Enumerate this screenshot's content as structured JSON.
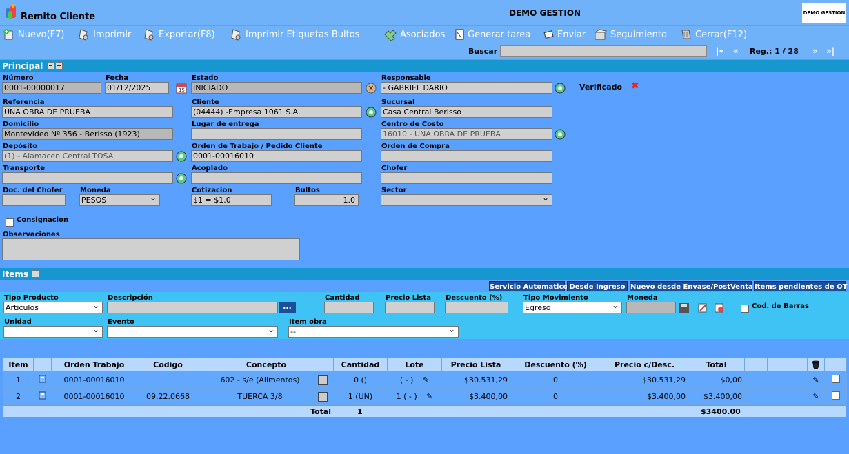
{
  "header": {
    "title": "Remito Cliente",
    "company": "DEMO GESTION",
    "brand_logo": "DEMO GESTION"
  },
  "toolbar": [
    {
      "label": "Nuevo(F7)",
      "icon": "new-icon"
    },
    {
      "label": "Imprimir",
      "icon": "print-icon"
    },
    {
      "label": "Exportar(F8)",
      "icon": "export-icon"
    },
    {
      "label": "Imprimir Etiquetas Bultos",
      "icon": "print-labels-icon"
    },
    {
      "label": "Asociados",
      "icon": "associated-icon"
    },
    {
      "label": "Generar tarea",
      "icon": "task-icon"
    },
    {
      "label": "Enviar",
      "icon": "send-icon"
    },
    {
      "label": "Seguimiento",
      "icon": "tracking-icon"
    },
    {
      "label": "Cerrar(F12)",
      "icon": "close-icon"
    }
  ],
  "search": {
    "label": "Buscar",
    "value": "",
    "first": "|«",
    "prev": "«",
    "reg": "Reg.: 1 / 28",
    "next": "»",
    "last": "»|"
  },
  "principal": {
    "section_title": "Principal",
    "numero_label": "Número",
    "numero": "0001-00000017",
    "fecha_label": "Fecha",
    "fecha": "01/12/2025",
    "estado_label": "Estado",
    "estado": "INICIADO",
    "responsable_label": "Responsable",
    "responsable": "- GABRIEL DARIO",
    "verificado_label": "Verificado",
    "referencia_label": "Referencia",
    "referencia": "UNA OBRA DE PRUEBA",
    "cliente_label": "Cliente",
    "cliente": "(04444) -Empresa 1061 S.A.",
    "sucursal_label": "Sucursal",
    "sucursal": "Casa Central Berisso",
    "domicilio_label": "Domicilio",
    "domicilio": "Montevideo Nº 356 - Berisso (1923)",
    "lugar_label": "Lugar de entrega",
    "lugar": "",
    "centro_label": "Centro de Costo",
    "centro": "16010 - UNA OBRA DE PRUEBA",
    "deposito_label": "Depósito",
    "deposito": "(1) - Alamacen Central TOSA",
    "orden_trabajo_label": "Orden de Trabajo / Pedido Cliente",
    "orden_trabajo": "0001-00016010",
    "orden_compra_label": "Orden de Compra",
    "orden_compra": "",
    "transporte_label": "Transporte",
    "transporte": "",
    "acoplado_label": "Acoplado",
    "acoplado": "",
    "chofer_label": "Chofer",
    "chofer": "",
    "doc_chofer_label": "Doc. del Chofer",
    "doc_chofer": "",
    "moneda_label": "Moneda",
    "moneda": "PESOS",
    "cotizacion_label": "Cotizacion",
    "cotizacion": "$1 = $1.0",
    "bultos_label": "Bultos",
    "bultos": "1.0",
    "sector_label": "Sector",
    "sector": "",
    "consignacion_label": "Consignacion",
    "observaciones_label": "Observaciones",
    "observaciones": ""
  },
  "items": {
    "section_title": "Items",
    "tabs": [
      "Servicio Automatico",
      "Desde Ingreso",
      "Nuevo desde Envase/PostVenta",
      "Items pendientes de OT"
    ],
    "form": {
      "tipo_producto_label": "Tipo Producto",
      "tipo_producto": "Articulos",
      "descripcion_label": "Descripción",
      "descripcion": "",
      "browse": "...",
      "cantidad_label": "Cantidad",
      "precio_lista_label": "Precio Lista",
      "descuento_label": "Descuento (%)",
      "tipo_movimiento_label": "Tipo Movimiento",
      "tipo_movimiento": "Egreso",
      "moneda_label": "Moneda",
      "cod_barras_label": "Cod. de Barras",
      "unidad_label": "Unidad",
      "evento_label": "Evento",
      "item_obra_label": "Item obra",
      "item_obra": "--"
    },
    "columns": [
      "Item",
      "",
      "Orden Trabajo",
      "Codigo",
      "Concepto",
      "Cantidad",
      "Lote",
      "Precio Lista",
      "Descuento (%)",
      "Precio c/Desc.",
      "Total"
    ],
    "rows": [
      {
        "item": "1",
        "orden": "0001-00016010",
        "codigo": "",
        "concepto": "602 - s/e (Alimentos)",
        "cantidad": "0 ()",
        "lote": "( - )",
        "precio_lista": "$30.531,29",
        "descuento": "0",
        "precio_desc": "$30.531,29",
        "total": "$0,00"
      },
      {
        "item": "2",
        "orden": "0001-00016010",
        "codigo": "09.22.0668",
        "concepto": "TUERCA 3/8",
        "cantidad": "1 (UN)",
        "lote": "1 ( - )",
        "precio_lista": "$3.400,00",
        "descuento": "0",
        "precio_desc": "$3.400,00",
        "total": "$3.400,00"
      }
    ],
    "totals": {
      "label": "Total",
      "cantidad": "1",
      "total": "$3400.00"
    }
  },
  "colors": {
    "background": "#5aa0ff",
    "section": "#1797cf",
    "form_area": "#3ec3f4",
    "tab": "#1a4f9a"
  }
}
